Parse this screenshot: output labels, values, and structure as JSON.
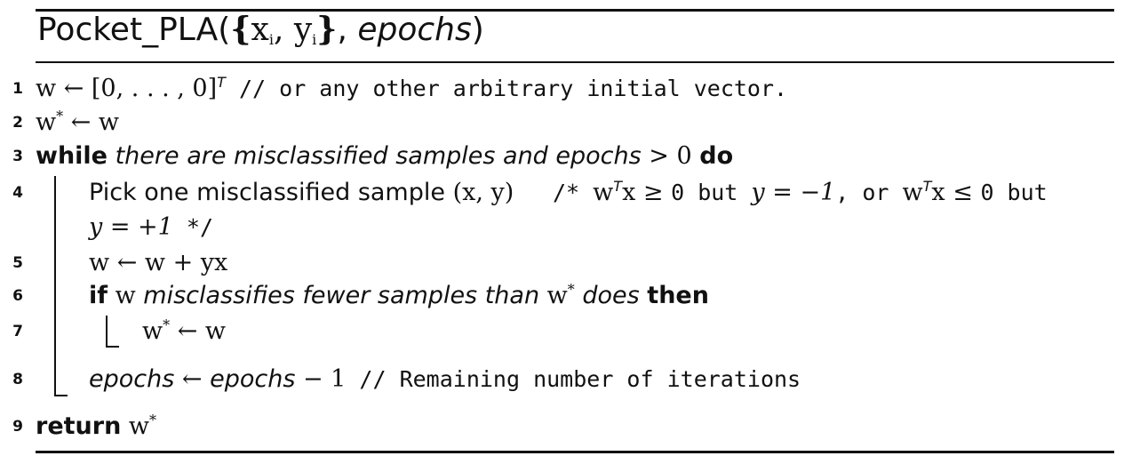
{
  "title": {
    "name": "Pocket_PLA(",
    "brace_open": "{",
    "x": "x",
    "x_sub": "i",
    "sep": ", ",
    "y": "y",
    "y_sub": "i",
    "brace_close": "}",
    "comma": ", ",
    "param": "epochs",
    "close": ")"
  },
  "lines": [
    {
      "num": "1",
      "w": "w ← [0, . . . , 0]",
      "sup": "T",
      "comment": " // or any other arbitrary initial vector."
    },
    {
      "num": "2",
      "w": "w",
      "sup": "*",
      "rest": " ← w"
    },
    {
      "num": "3",
      "kw": "while",
      "cond": "there are misclassified samples and epochs",
      "op": " > 0 ",
      "kw2": "do"
    },
    {
      "num": "4",
      "text": "Pick one misclassified sample ",
      "pair": "(x, y)",
      "c_open": "/* ",
      "w": "w",
      "sup": "T",
      "x_ge": "x ≥ ",
      "zero": "0",
      "but1": " but ",
      "y_eq": "y = −1",
      "or_text": ", or ",
      "w2": "w",
      "sup2": "T",
      "x_le": "x ≤ ",
      "zero2": "0",
      "but2": " but",
      "cont": "y = +1",
      "c_close": " */"
    },
    {
      "num": "5",
      "text": "w ← w + yx"
    },
    {
      "num": "6",
      "kw": "if",
      "w": " w ",
      "cond": "misclassifies fewer samples than",
      "w2": " w",
      "sup": "*",
      "cond2": " does",
      "kw2": "then"
    },
    {
      "num": "7",
      "w": "w",
      "sup": "*",
      "rest": " ← w"
    },
    {
      "num": "8",
      "lhs": "epochs",
      "arrow": " ← ",
      "rhs": "epochs",
      "rest": " − 1",
      "comment": " // Remaining number of iterations"
    },
    {
      "num": "9",
      "kw": "return",
      "w": " w",
      "sup": "*"
    }
  ]
}
